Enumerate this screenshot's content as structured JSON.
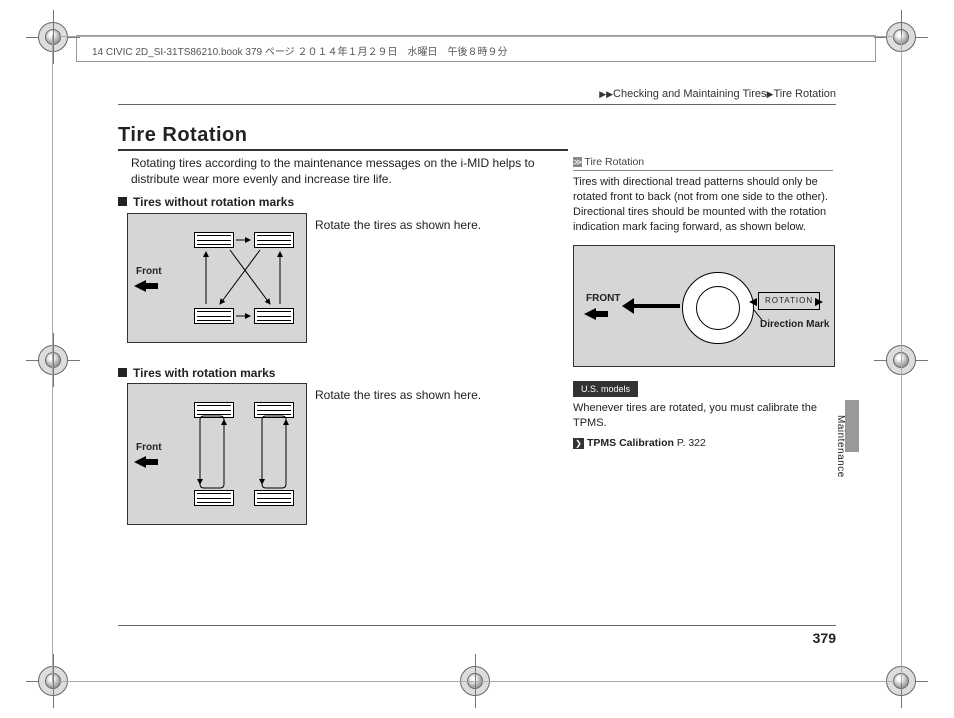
{
  "header_strip": "14 CIVIC 2D_SI-31TS86210.book  379 ページ  ２０１４年１月２９日　水曜日　午後８時９分",
  "breadcrumb": {
    "a": "Checking and Maintaining Tires",
    "b": "Tire Rotation"
  },
  "title": "Tire Rotation",
  "intro": "Rotating tires according to the maintenance messages on the i-MID helps to distribute wear more evenly and increase tire life.",
  "section1": {
    "heading": "Tires without rotation marks",
    "text": "Rotate the tires as shown here.",
    "front": "Front"
  },
  "section2": {
    "heading": "Tires with rotation marks",
    "text": "Rotate the tires as shown here.",
    "front": "Front"
  },
  "sidebar": {
    "title": "Tire Rotation",
    "text": "Tires with directional tread patterns should only be rotated front to back (not from one side to the other). Directional tires should be mounted with the rotation indication mark facing forward, as shown below.",
    "front": "FRONT",
    "rotation": "ROTATION",
    "direction_mark": "Direction Mark",
    "badge": "U.S. models",
    "note": "Whenever tires are rotated, you must calibrate the TPMS.",
    "ref_label": "TPMS Calibration",
    "ref_page": "P. 322"
  },
  "side_tab": "Maintenance",
  "page_number": "379"
}
